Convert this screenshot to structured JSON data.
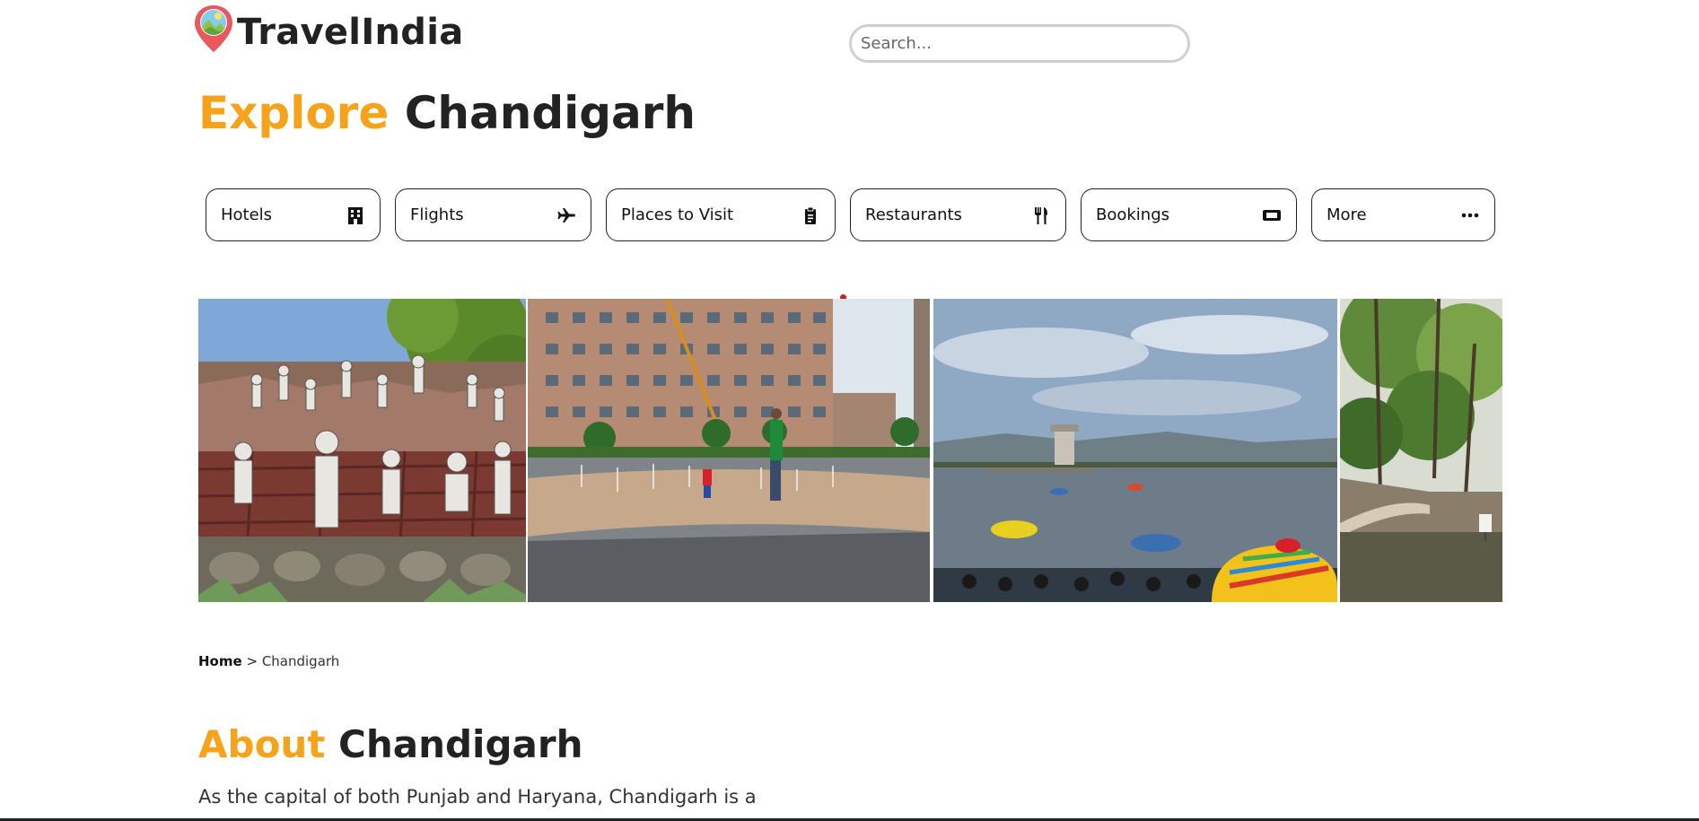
{
  "header": {
    "logo_text": "TravelIndia",
    "search": {
      "placeholder": "Search...",
      "value": ""
    }
  },
  "hero": {
    "title_accent": "Explore",
    "title_main": "Chandigarh"
  },
  "categories": [
    {
      "label": "Hotels",
      "icon": "hotel-icon"
    },
    {
      "label": "Flights",
      "icon": "plane-icon"
    },
    {
      "label": "Places to Visit",
      "icon": "clipboard-icon"
    },
    {
      "label": "Restaurants",
      "icon": "utensils-icon"
    },
    {
      "label": "Bookings",
      "icon": "ticket-icon"
    },
    {
      "label": "More",
      "icon": "ellipsis-icon"
    }
  ],
  "gallery": {
    "photos": [
      {
        "icon": "rock-garden-sculptures-photo"
      },
      {
        "icon": "plaza-fountain-building-photo"
      },
      {
        "icon": "sukhna-lake-boats-photo"
      },
      {
        "icon": "garden-pond-trees-photo"
      }
    ]
  },
  "breadcrumb": {
    "home": "Home",
    "separator": ">",
    "current": "Chandigarh"
  },
  "about": {
    "title_accent": "About",
    "title_main": "Chandigarh",
    "text": "As the capital of both Punjab and Haryana, Chandigarh is a principal"
  },
  "colors": {
    "accent": "#f7a21b",
    "text_dark": "#222222",
    "indicator": "#d31a1a"
  }
}
